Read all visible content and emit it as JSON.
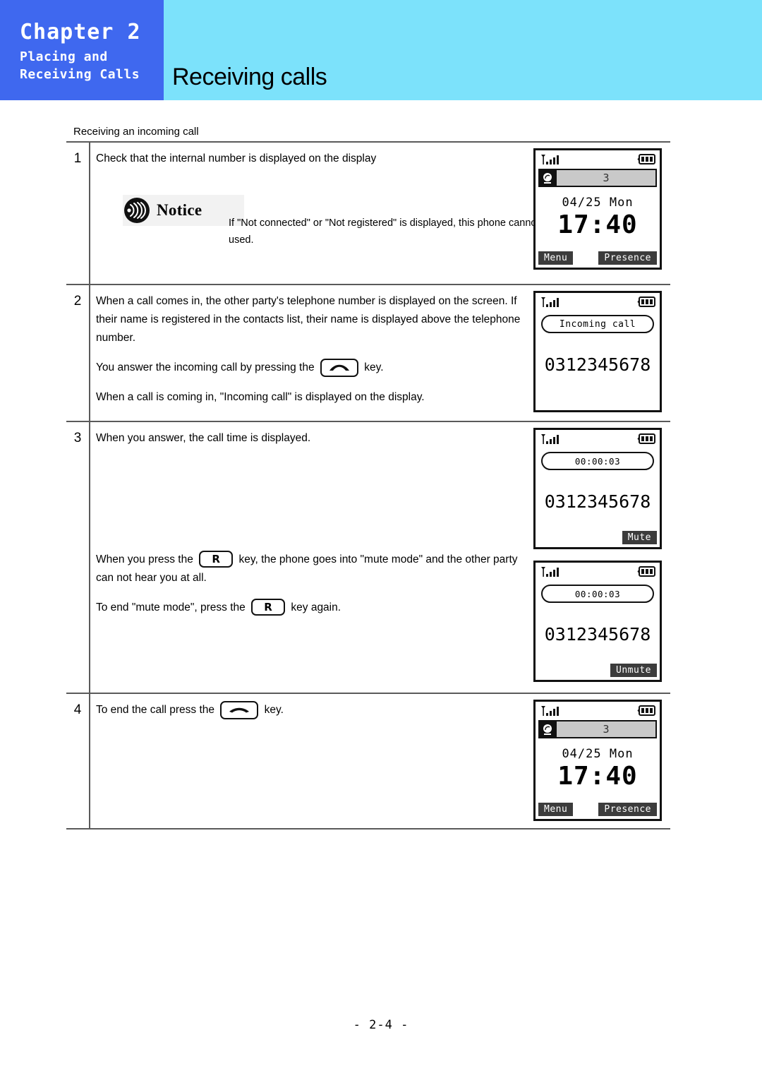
{
  "header": {
    "chapter_label": "Chapter 2",
    "chapter_sub_line1": "Placing and",
    "chapter_sub_line2": "Receiving Calls",
    "page_title": "Receiving calls",
    "chapter_block_color": "#3f68ef",
    "banner_color": "#7ce2fb"
  },
  "section": {
    "label": "Receiving an incoming call"
  },
  "steps": [
    {
      "number": "1",
      "paragraphs": [
        "Check that the internal number is displayed on the display"
      ],
      "notice": {
        "label": "Notice",
        "icon": "sound-wave-icon",
        "text": "If \"Not connected\" or \"Not registered\" is displayed, this phone cannot be used."
      }
    },
    {
      "number": "2",
      "paragraphs": [
        "When a call comes in, the other party's telephone number is displayed on the screen. If their name is registered in the contacts list, their name is displayed above the telephone number.",
        "When a call is coming in, \"Incoming call\" is displayed on the display."
      ],
      "answer_line": {
        "before": "You answer the incoming call by pressing the",
        "key": "handset-answer-key",
        "after": "key."
      }
    },
    {
      "number": "3",
      "paragraphs": [
        "When you answer, the call time is displayed."
      ],
      "mute_line": {
        "before": "When you press the",
        "key_label": "R",
        "after": "key, the phone goes into \"mute mode\" and the other party can not hear you at all."
      },
      "unmute_line": {
        "before": "To end \"mute mode\", press the",
        "key_label": "R",
        "after": "key again."
      }
    },
    {
      "number": "4",
      "end_line": {
        "before": "To end the call press the",
        "key": "handset-end-key",
        "after": "key."
      }
    }
  ],
  "phone_screens": {
    "idle_1": {
      "signal_icon": "antenna-signal-icon",
      "battery_icon": "battery-full-icon",
      "line_icon": "ringer-icon",
      "line_number": "3",
      "date": "04/25 Mon",
      "time": "17:40",
      "softkey_left": "Menu",
      "softkey_right": "Presence"
    },
    "incoming": {
      "signal_icon": "antenna-signal-icon",
      "battery_icon": "battery-full-icon",
      "status_pill": "Incoming call",
      "number": "0312345678"
    },
    "talking_mute": {
      "signal_icon": "antenna-signal-icon",
      "battery_icon": "battery-full-icon",
      "timer": "00:00:03",
      "number": "0312345678",
      "softkey_right": "Mute"
    },
    "talking_unmute": {
      "signal_icon": "antenna-signal-icon",
      "battery_icon": "battery-full-icon",
      "timer": "00:00:03",
      "number": "0312345678",
      "softkey_right": "Unmute"
    },
    "idle_2": {
      "signal_icon": "antenna-signal-icon",
      "battery_icon": "battery-full-icon",
      "line_icon": "ringer-icon",
      "line_number": "3",
      "date": "04/25 Mon",
      "time": "17:40",
      "softkey_left": "Menu",
      "softkey_right": "Presence"
    }
  },
  "footer": {
    "page_number": "- 2-4 -"
  }
}
